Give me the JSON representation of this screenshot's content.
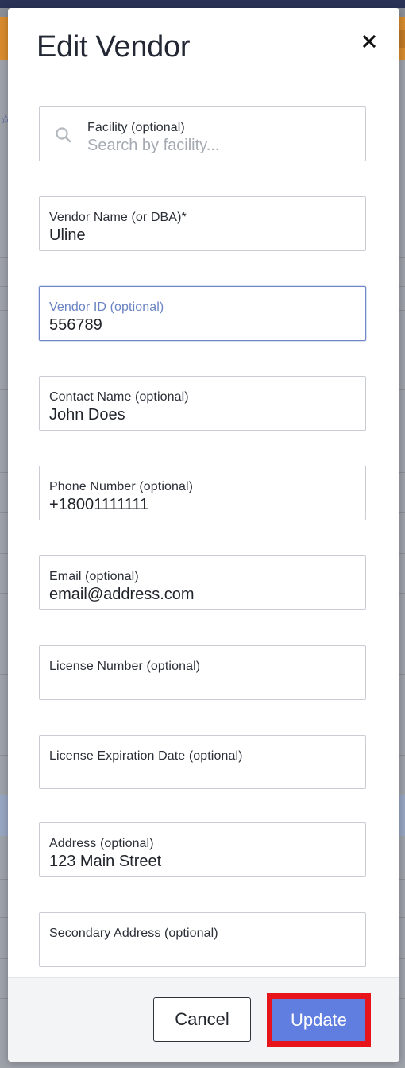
{
  "modal": {
    "title": "Edit Vendor",
    "close_icon": "close-icon"
  },
  "fields": [
    {
      "label": "Facility (optional)",
      "value": "",
      "placeholder": "Search by facility...",
      "icon": "search-icon"
    },
    {
      "label": "Vendor Name (or DBA)*",
      "value": "Uline"
    },
    {
      "label": "Vendor ID (optional)",
      "value": "556789",
      "focused": true
    },
    {
      "label": "Contact Name (optional)",
      "value": "John Does"
    },
    {
      "label": "Phone Number (optional)",
      "value": "+18001111111"
    },
    {
      "label": "Email (optional)",
      "value": "email@address.com"
    },
    {
      "label": "License Number (optional)",
      "value": ""
    },
    {
      "label": "License Expiration Date (optional)",
      "value": ""
    },
    {
      "label": "Address (optional)",
      "value": "123 Main Street"
    },
    {
      "label": "Secondary Address (optional)",
      "value": ""
    }
  ],
  "footer": {
    "cancel_label": "Cancel",
    "update_label": "Update"
  },
  "colors": {
    "primary": "#5f7ee0",
    "focus_label": "#6a83c3",
    "highlight_outline": "#e8141c",
    "header_orange": "#d88b2e",
    "top_bar": "#2a3356"
  }
}
